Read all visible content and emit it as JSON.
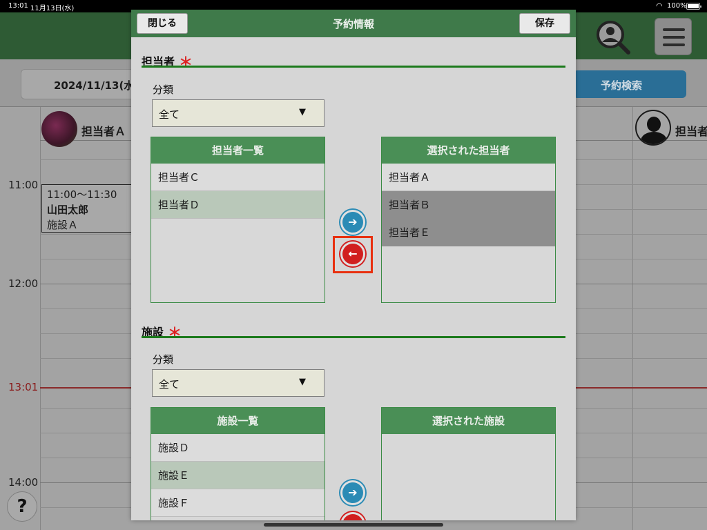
{
  "status_bar": {
    "time": "13:01",
    "date": "11月13日(水)",
    "battery": "100%"
  },
  "background": {
    "date_label": "2024/11/13(水",
    "search_reservation_label": "予約検索",
    "staff_columns": [
      "担当者Ａ",
      "担当者Ｅ"
    ],
    "time_labels": [
      "11:00",
      "12:00",
      "13:01",
      "14:00"
    ],
    "event": {
      "time": "11:00～11:30",
      "name": "山田太郎",
      "facility": "施設Ａ"
    },
    "help_label": "?"
  },
  "modal": {
    "title": "予約情報",
    "close_label": "閉じる",
    "save_label": "保存",
    "staff_section": {
      "title": "担当者",
      "required_mark": "＊",
      "category_label": "分類",
      "category_value": "全て",
      "available_header": "担当者一覧",
      "available": [
        "担当者Ｃ",
        "担当者Ｄ"
      ],
      "selected_header": "選択された担当者",
      "selected": [
        "担当者Ａ",
        "担当者Ｂ",
        "担当者Ｅ"
      ]
    },
    "facility_section": {
      "title": "施設",
      "required_mark": "＊",
      "category_label": "分類",
      "category_value": "全て",
      "available_header": "施設一覧",
      "available": [
        "施設Ｄ",
        "施設Ｅ",
        "施設Ｆ"
      ],
      "selected_header": "選択された施設",
      "selected": []
    }
  },
  "colors": {
    "header_green": "#3f7a4a",
    "list_header_green": "#4a8f56",
    "rule_green": "#1c7a1c",
    "move_right_blue": "#2b8bb5",
    "move_left_red": "#d11f1f",
    "highlight_red": "#e8300f"
  }
}
